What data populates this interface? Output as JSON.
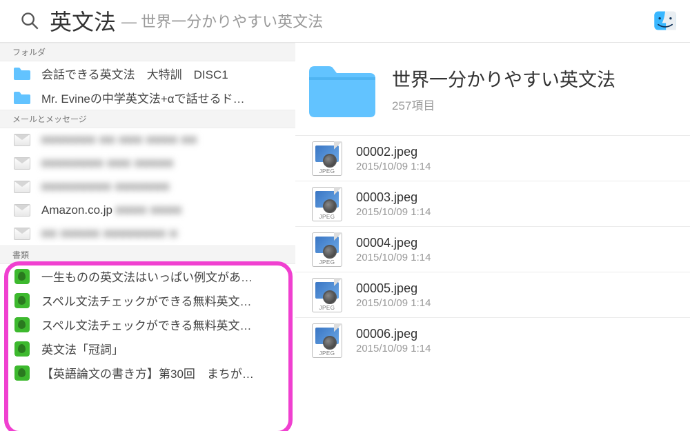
{
  "search": {
    "query": "英文法",
    "context_prefix": "—",
    "context": "世界一分かりやすい英文法"
  },
  "sidebar": {
    "sections": [
      {
        "header": "フォルダ",
        "kind": "folder",
        "items": [
          {
            "label": "会話できる英文法　大特訓　DISC1"
          },
          {
            "label": "Mr. Evineの中学英文法+αで話せるド…"
          }
        ]
      },
      {
        "header": "メールとメッセージ",
        "kind": "mail",
        "items": [
          {
            "label": "■■■■■■■ ■■ ■■■ ■■■■ ■■",
            "blurred": true
          },
          {
            "label": "■■■■■■■■ ■■■ ■■■■■",
            "blurred": true
          },
          {
            "label": "■■■■■■■■■ ■■■■■■■",
            "blurred": true
          },
          {
            "label": "Amazon.co.jp ■■■■ ■■■■",
            "blurred_partial": true
          },
          {
            "label": "■■ ■■■■■ ■■■■■■■■ ■",
            "blurred": true
          }
        ]
      },
      {
        "header": "書類",
        "kind": "document",
        "items": [
          {
            "label": "一生ものの英文法はいっぱい例文があ…"
          },
          {
            "label": "スペル文法チェックができる無料英文…"
          },
          {
            "label": "スペル文法チェックができる無料英文…"
          },
          {
            "label": "英文法「冠詞」"
          },
          {
            "label": "【英語論文の書き方】第30回　まちが…"
          }
        ]
      }
    ]
  },
  "main": {
    "title": "世界一分かりやすい英文法",
    "item_count_label": "257項目",
    "files": [
      {
        "name": "00002.jpeg",
        "date": "2015/10/09 1:14"
      },
      {
        "name": "00003.jpeg",
        "date": "2015/10/09 1:14"
      },
      {
        "name": "00004.jpeg",
        "date": "2015/10/09 1:14"
      },
      {
        "name": "00005.jpeg",
        "date": "2015/10/09 1:14"
      },
      {
        "name": "00006.jpeg",
        "date": "2015/10/09 1:14"
      }
    ],
    "jpeg_badge": "JPEG"
  }
}
